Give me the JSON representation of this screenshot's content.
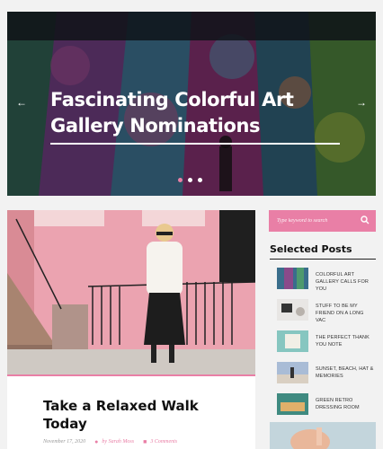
{
  "hero": {
    "title": "Fascinating Colorful Art Gallery Nominations",
    "prev_icon": "arrow-left-icon",
    "next_icon": "arrow-right-icon",
    "slides_count": 3,
    "active_slide": 1
  },
  "post": {
    "title": "Take a Relaxed Walk Today",
    "date": "November 17, 2020",
    "author": "by Sarah Moss",
    "comments": "3 Comments"
  },
  "sidebar": {
    "search_placeholder": "Type keyword to search",
    "selected_title": "Selected Posts",
    "posts": [
      {
        "title": "Colorful Art Gallery Calls for You"
      },
      {
        "title": "Stuff to Be My Friend on a Long Vac"
      },
      {
        "title": "The Perfect Thank You Note"
      },
      {
        "title": "Sunset, Beach, Hat & Memories"
      },
      {
        "title": "Green Retro Dressing Room"
      }
    ]
  },
  "colors": {
    "accent": "#e97fa6",
    "background": "#f2f2f2"
  }
}
